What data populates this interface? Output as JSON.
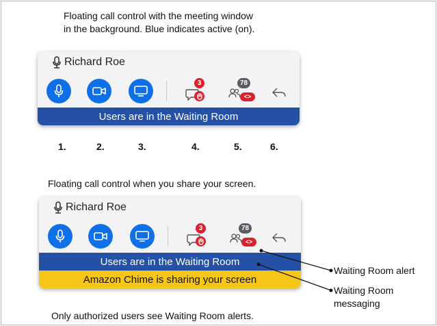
{
  "captions": {
    "top": [
      "Floating call control with the meeting window",
      "in the background. Blue indicates active (on)."
    ],
    "middle": "Floating call control when you share your screen.",
    "bottom": "Only authorized users see Waiting Room alerts."
  },
  "panel_top": {
    "name": "Richard Roe",
    "chat_badge": "3",
    "attendee_count": "78",
    "attendee_badge": "<>",
    "waiting_banner": "Users are in the Waiting Room"
  },
  "panel_bottom": {
    "name": "Richard Roe",
    "chat_badge": "3",
    "attendee_count": "78",
    "attendee_badge": "<>",
    "waiting_banner": "Users are in the Waiting Room",
    "share_banner": "Amazon Chime is sharing your screen"
  },
  "numbers": [
    "1.",
    "2.",
    "3.",
    "4.",
    "5.",
    "6."
  ],
  "callouts": {
    "alert": "Waiting Room alert",
    "messaging_line1": "Waiting Room",
    "messaging_line2": "messaging"
  },
  "colors": {
    "active_blue": "#0f6fe6",
    "banner_blue": "#2451a6",
    "banner_yellow": "#f5c518",
    "badge_red": "#d9222f"
  }
}
